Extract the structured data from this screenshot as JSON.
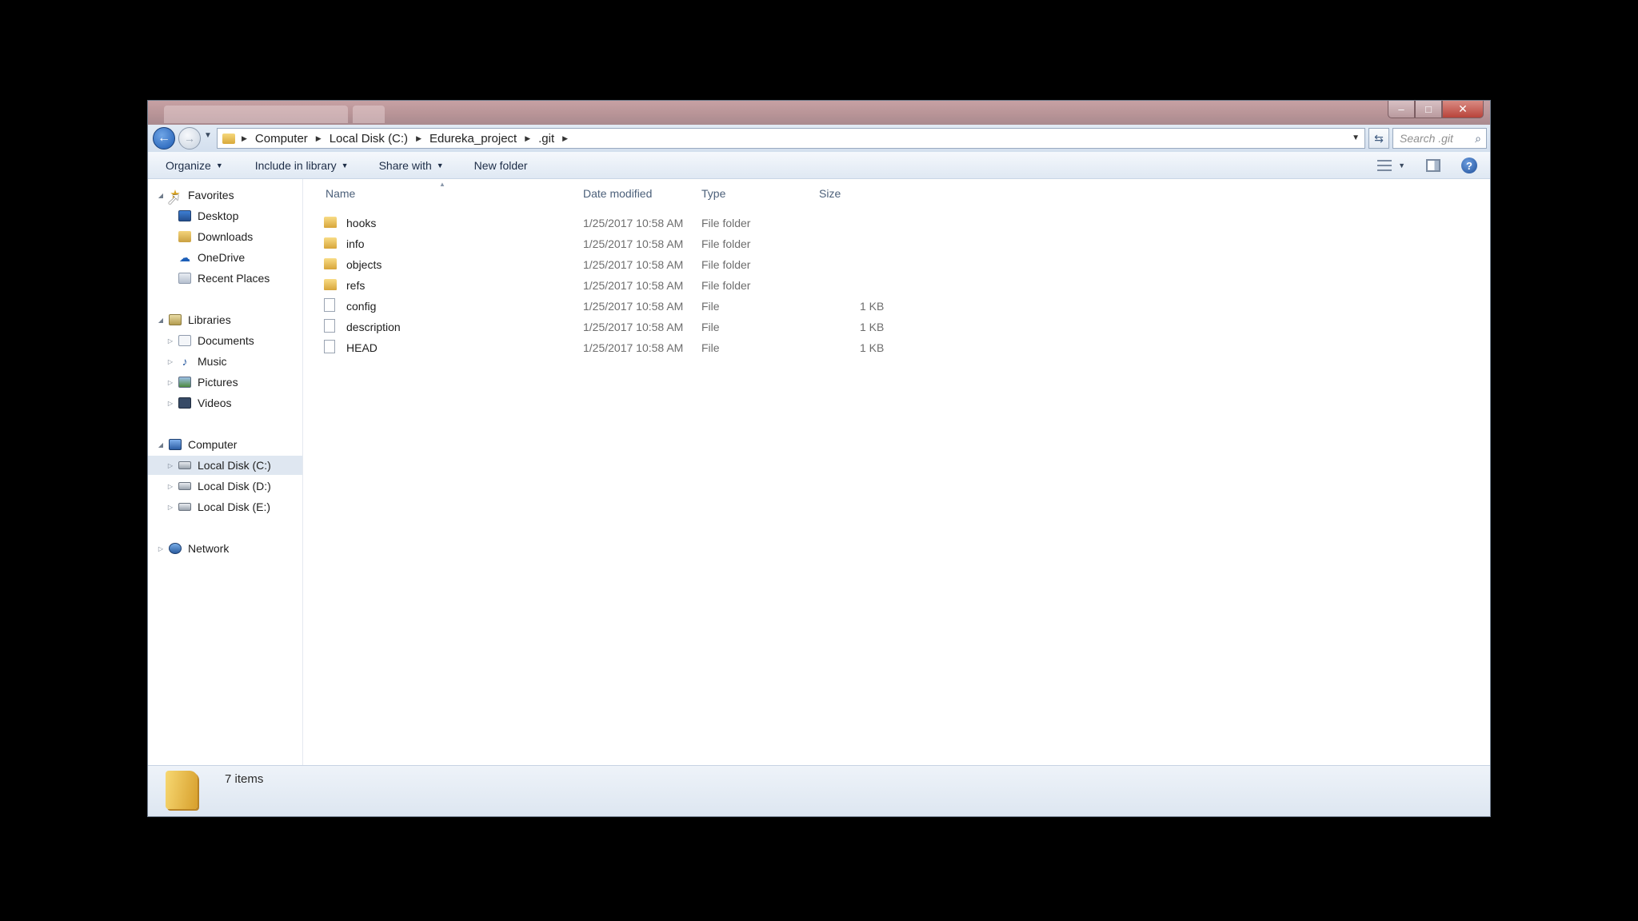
{
  "window": {
    "controls": {
      "minimize": "–",
      "maximize": "□",
      "close": "✕"
    }
  },
  "address_bar": {
    "crumbs": [
      "Computer",
      "Local Disk (C:)",
      "Edureka_project",
      ".git"
    ],
    "search_placeholder": "Search .git"
  },
  "toolbar": {
    "organize": "Organize",
    "include_in_library": "Include in library",
    "share_with": "Share with",
    "new_folder": "New folder"
  },
  "nav": {
    "favorites": {
      "label": "Favorites",
      "items": [
        "Desktop",
        "Downloads",
        "OneDrive",
        "Recent Places"
      ]
    },
    "libraries": {
      "label": "Libraries",
      "items": [
        "Documents",
        "Music",
        "Pictures",
        "Videos"
      ]
    },
    "computer": {
      "label": "Computer",
      "items": [
        "Local Disk (C:)",
        "Local Disk (D:)",
        "Local Disk (E:)"
      ],
      "selected": "Local Disk (C:)"
    },
    "network": {
      "label": "Network"
    }
  },
  "columns": {
    "name": "Name",
    "date": "Date modified",
    "type": "Type",
    "size": "Size"
  },
  "files": [
    {
      "name": "hooks",
      "date": "1/25/2017 10:58 AM",
      "type": "File folder",
      "size": "",
      "kind": "folder"
    },
    {
      "name": "info",
      "date": "1/25/2017 10:58 AM",
      "type": "File folder",
      "size": "",
      "kind": "folder"
    },
    {
      "name": "objects",
      "date": "1/25/2017 10:58 AM",
      "type": "File folder",
      "size": "",
      "kind": "folder"
    },
    {
      "name": "refs",
      "date": "1/25/2017 10:58 AM",
      "type": "File folder",
      "size": "",
      "kind": "folder"
    },
    {
      "name": "config",
      "date": "1/25/2017 10:58 AM",
      "type": "File",
      "size": "1 KB",
      "kind": "file"
    },
    {
      "name": "description",
      "date": "1/25/2017 10:58 AM",
      "type": "File",
      "size": "1 KB",
      "kind": "file"
    },
    {
      "name": "HEAD",
      "date": "1/25/2017 10:58 AM",
      "type": "File",
      "size": "1 KB",
      "kind": "file"
    }
  ],
  "status": {
    "item_count": "7 items"
  },
  "colors": {
    "accent": "#1d5bb3",
    "folder": "#e4b94e",
    "titlebar": "#b89497"
  }
}
